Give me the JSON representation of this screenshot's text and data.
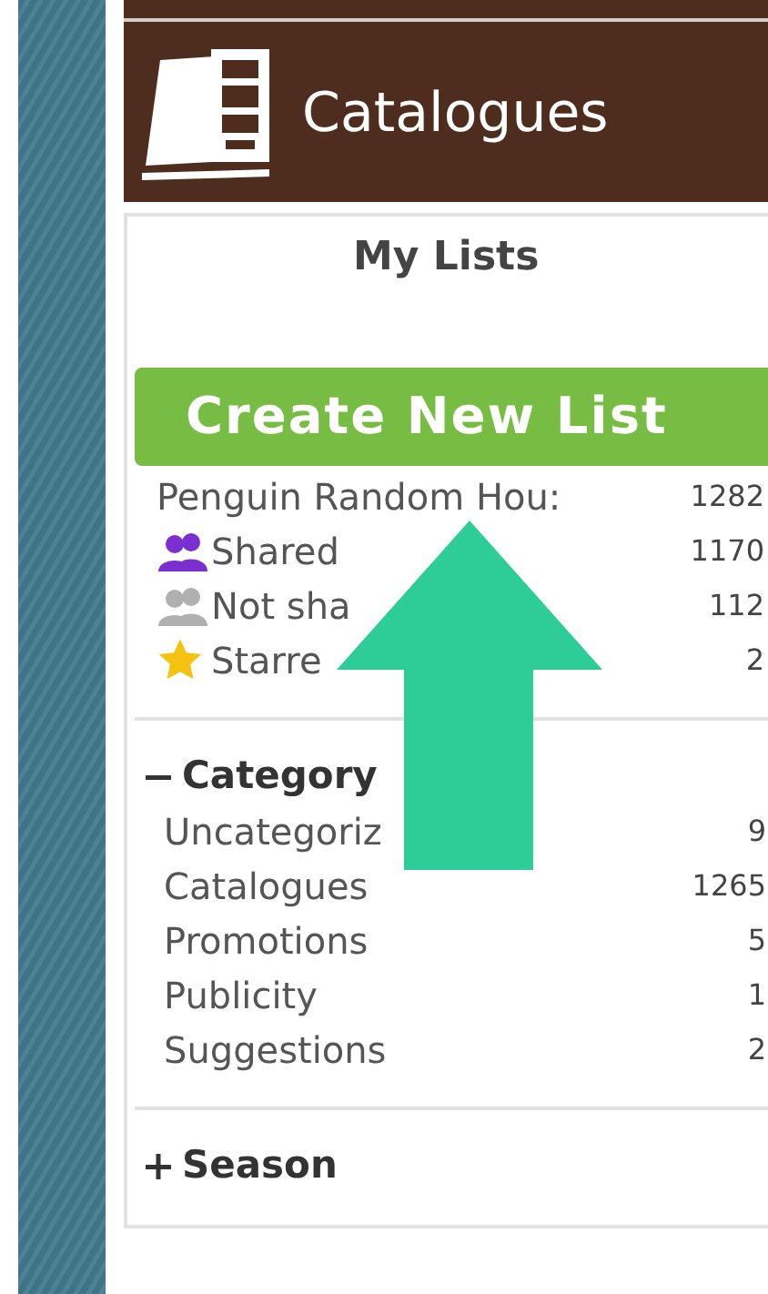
{
  "header": {
    "title": "Catalogues"
  },
  "my_lists": {
    "title": "My Lists",
    "create_button": "Create New List",
    "items": [
      {
        "kind": "plain",
        "name": "Penguin Random Hou:",
        "count": "1282"
      },
      {
        "kind": "shared",
        "name": "Shared",
        "count": "1170"
      },
      {
        "kind": "not_shared",
        "name": "Not sha",
        "count": "112"
      },
      {
        "kind": "starred",
        "name": "Starre",
        "count": "2"
      }
    ]
  },
  "groups": [
    {
      "title": "Category",
      "expanded": true,
      "items": [
        {
          "name": "Uncategoriz",
          "count": "9"
        },
        {
          "name": "Catalogues",
          "count": "1265"
        },
        {
          "name": "Promotions",
          "count": "5"
        },
        {
          "name": "Publicity",
          "count": "1"
        },
        {
          "name": "Suggestions",
          "count": "2"
        }
      ]
    },
    {
      "title": "Season",
      "expanded": false
    }
  ]
}
